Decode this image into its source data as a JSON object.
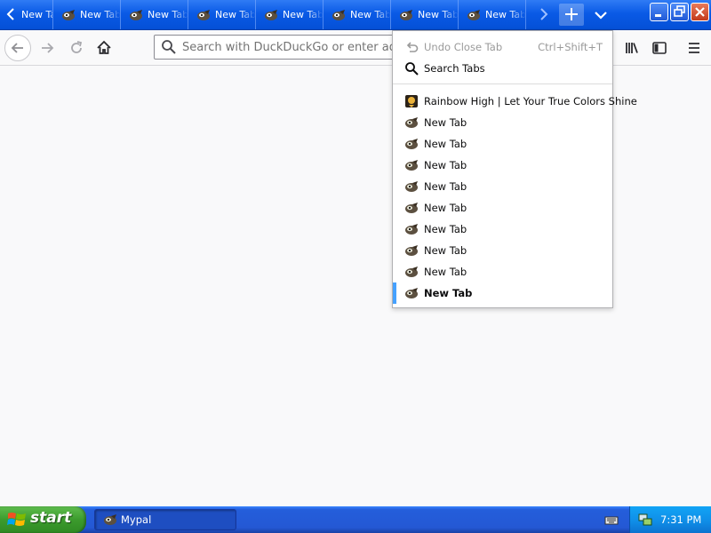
{
  "browser": {
    "tabs": [
      {
        "label": "New Tab",
        "partial": true
      },
      {
        "label": "New Tab"
      },
      {
        "label": "New Tab"
      },
      {
        "label": "New Tab"
      },
      {
        "label": "New Tab"
      },
      {
        "label": "New Tab"
      },
      {
        "label": "New Tab"
      },
      {
        "label": "New Tab"
      }
    ],
    "urlbar": {
      "placeholder": "Search with DuckDuckGo or enter address",
      "value": ""
    }
  },
  "alltabs_menu": {
    "undo_close_tab": {
      "label": "Undo Close Tab",
      "shortcut": "Ctrl+Shift+T",
      "enabled": false
    },
    "search_tabs": {
      "label": "Search Tabs"
    },
    "items": [
      {
        "label": "Rainbow High | Let Your True Colors Shine",
        "icon": "rainbow-high-favicon"
      },
      {
        "label": "New Tab",
        "icon": "mypal-favicon"
      },
      {
        "label": "New Tab",
        "icon": "mypal-favicon"
      },
      {
        "label": "New Tab",
        "icon": "mypal-favicon"
      },
      {
        "label": "New Tab",
        "icon": "mypal-favicon"
      },
      {
        "label": "New Tab",
        "icon": "mypal-favicon"
      },
      {
        "label": "New Tab",
        "icon": "mypal-favicon"
      },
      {
        "label": "New Tab",
        "icon": "mypal-favicon"
      },
      {
        "label": "New Tab",
        "icon": "mypal-favicon"
      },
      {
        "label": "New Tab",
        "icon": "mypal-favicon",
        "active": true
      }
    ]
  },
  "taskbar": {
    "start_label": "start",
    "tasks": [
      {
        "label": "Mypal",
        "icon": "mypal-favicon"
      }
    ],
    "clock": "7:31 PM"
  },
  "colors": {
    "titlebar": "#0a5ae6",
    "active_tab_marker": "#45a1ff",
    "start_green": "#3c9b2d",
    "tray_blue": "#0f8ce6"
  }
}
